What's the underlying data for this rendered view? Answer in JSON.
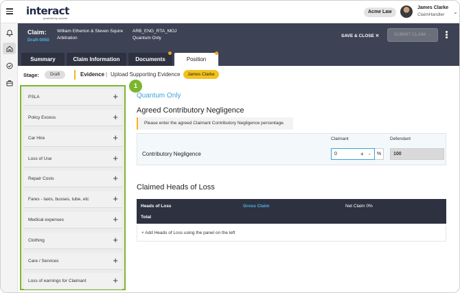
{
  "app": {
    "logo_main": "interact",
    "logo_sub": "powered by concise",
    "org": "Acme Law"
  },
  "user": {
    "name": "James Clarke",
    "role": "ClaimHandler"
  },
  "claim": {
    "label": "Claim:",
    "id": "Draft-0050",
    "parties": "William Etherton & Steven Squire",
    "type": "Arbitration",
    "code": "ARB_ENG_RTA_MOJ",
    "scope": "Quantum Only",
    "save_close": "SAVE & CLOSE ✕",
    "submit": "SUBMIT CLAIM →"
  },
  "tabs": [
    {
      "label": "Summary"
    },
    {
      "label": "Claim Information"
    },
    {
      "label": "Documents"
    },
    {
      "label": "Position"
    }
  ],
  "stage": {
    "label": "Stage:",
    "value": "Draft",
    "evidence_label": "Evidence",
    "separator": "|",
    "evidence_desc": "Upload Supporting Evidence",
    "assignee": "James Clarke"
  },
  "panel": {
    "badge": "1",
    "items": [
      {
        "label": "PSLA"
      },
      {
        "label": "Policy Excess"
      },
      {
        "label": "Car Hire"
      },
      {
        "label": "Loss of Use"
      },
      {
        "label": "Repair Costs"
      },
      {
        "label": "Fares - taxis, busses, tube, etc"
      },
      {
        "label": "Medical expenses"
      },
      {
        "label": "Clothing"
      },
      {
        "label": "Care / Services"
      },
      {
        "label": "Loss of earnings for Claimant"
      }
    ],
    "add_symbol": "+"
  },
  "main": {
    "scope_heading": "Quantum Only",
    "acn_title": "Agreed Contributory Negligence",
    "hint": "Please enter the agreed Claimant Contributory Negligence percentage.",
    "cn_label": "Contributory Negligence",
    "claimant_label": "Claimant",
    "defendant_label": "Defendant",
    "claimant_value": "0",
    "plus": "+",
    "minus": "-",
    "percent": "%",
    "defendant_value": "100",
    "chl_title": "Claimed Heads of Loss",
    "table": {
      "col1": "Heads of Loss",
      "col2": "Gross Claim",
      "col3": "Net Claim 0%",
      "total": "Total"
    },
    "add_hint": "+ Add Heads of Loss using the panel on the left"
  }
}
